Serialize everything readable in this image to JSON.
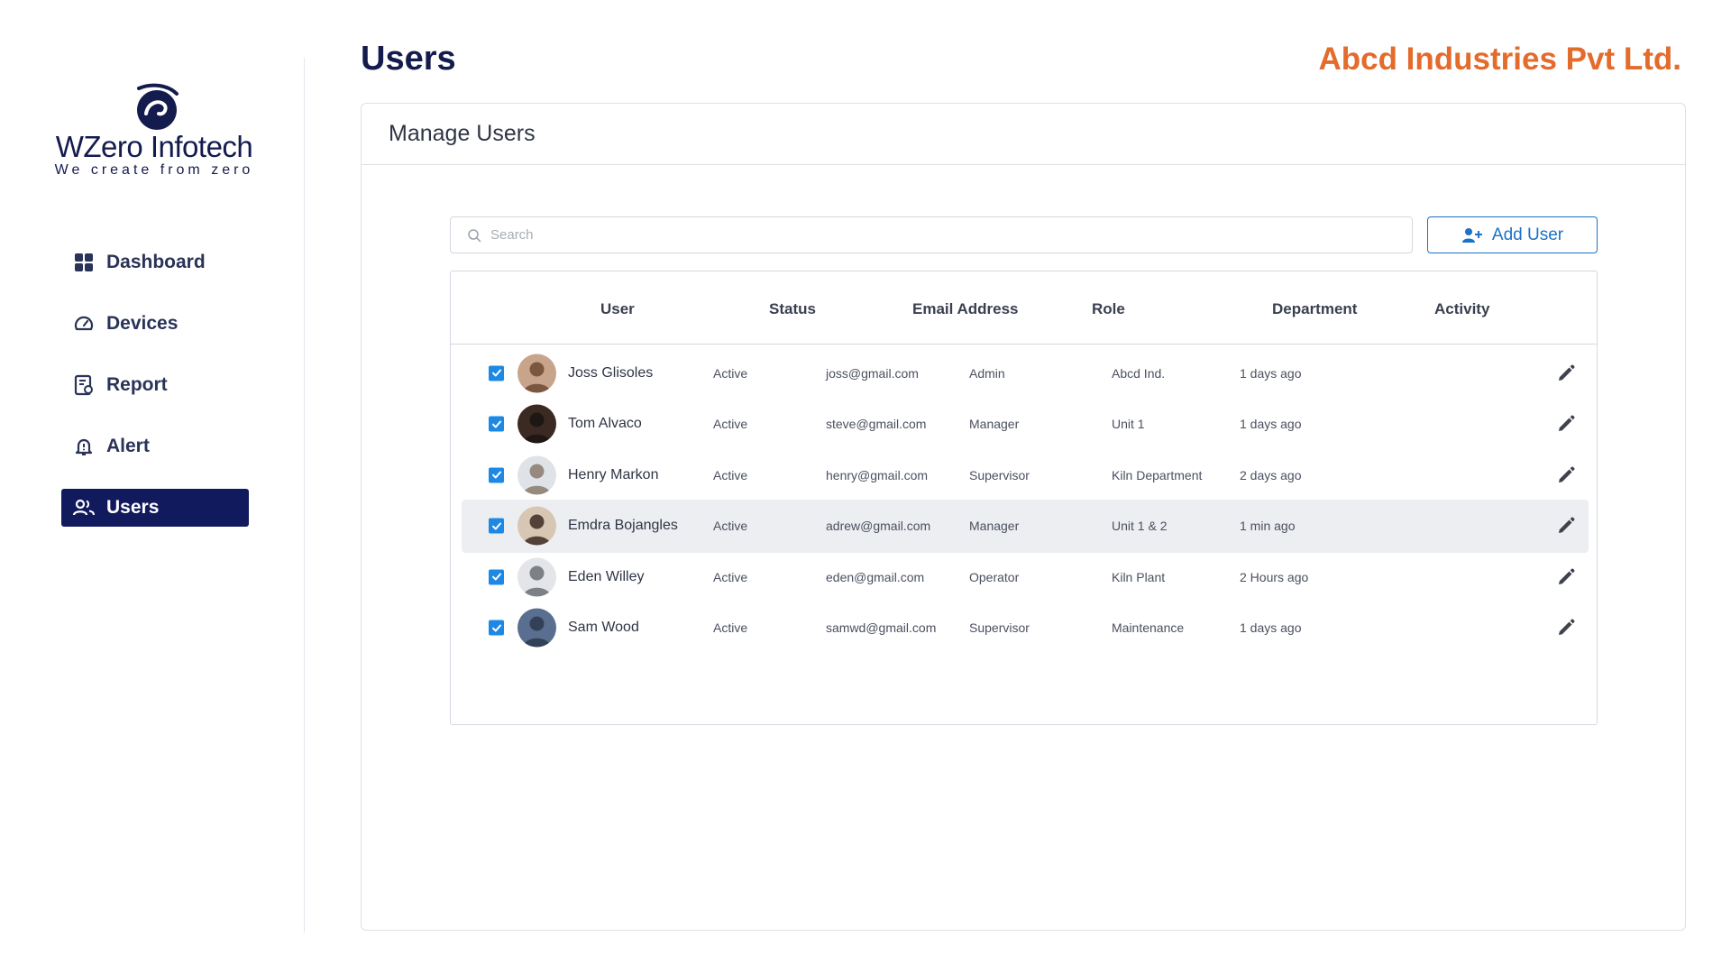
{
  "brand": {
    "name": "WZero Infotech",
    "tagline": "We create from zero"
  },
  "sidebar": {
    "items": [
      {
        "label": "Dashboard",
        "icon": "grid-icon",
        "active": false
      },
      {
        "label": "Devices",
        "icon": "gauge-icon",
        "active": false
      },
      {
        "label": "Report",
        "icon": "report-icon",
        "active": false
      },
      {
        "label": "Alert",
        "icon": "bell-icon",
        "active": false
      },
      {
        "label": "Users",
        "icon": "users-icon",
        "active": true
      }
    ]
  },
  "header": {
    "title": "Users",
    "company": "Abcd Industries Pvt Ltd."
  },
  "card": {
    "title": "Manage Users"
  },
  "search": {
    "placeholder": "Search",
    "value": ""
  },
  "toolbar": {
    "add_user_label": "Add User"
  },
  "table": {
    "columns": [
      "User",
      "Status",
      "Email Address",
      "Role",
      "Department",
      "Activity"
    ],
    "rows": [
      {
        "checked": true,
        "name": "Joss Glisoles",
        "status": "Active",
        "email": "joss@gmail.com",
        "role": "Admin",
        "department": "Abcd Ind.",
        "activity": "1 days ago",
        "highlighted": false
      },
      {
        "checked": true,
        "name": "Tom Alvaco",
        "status": "Active",
        "email": "steve@gmail.com",
        "role": "Manager",
        "department": "Unit 1",
        "activity": "1 days ago",
        "highlighted": false
      },
      {
        "checked": true,
        "name": "Henry Markon",
        "status": "Active",
        "email": "henry@gmail.com",
        "role": "Supervisor",
        "department": "Kiln Department",
        "activity": "2 days ago",
        "highlighted": false
      },
      {
        "checked": true,
        "name": "Emdra Bojangles",
        "status": "Active",
        "email": "adrew@gmail.com",
        "role": "Manager",
        "department": "Unit 1 & 2",
        "activity": "1 min ago",
        "highlighted": true
      },
      {
        "checked": true,
        "name": "Eden Willey",
        "status": "Active",
        "email": "eden@gmail.com",
        "role": "Operator",
        "department": "Kiln Plant",
        "activity": "2 Hours ago",
        "highlighted": false
      },
      {
        "checked": true,
        "name": "Sam Wood",
        "status": "Active",
        "email": "samwd@gmail.com",
        "role": "Supervisor",
        "department": "Maintenance",
        "activity": "1 days ago",
        "highlighted": false
      }
    ]
  },
  "colors": {
    "brand_navy": "#141b4d",
    "active_nav": "#121a5e",
    "company_orange": "#e36b2c",
    "accent_blue": "#1b72c6",
    "checkbox_blue": "#1e88e5",
    "row_highlight": "#eceef1"
  }
}
